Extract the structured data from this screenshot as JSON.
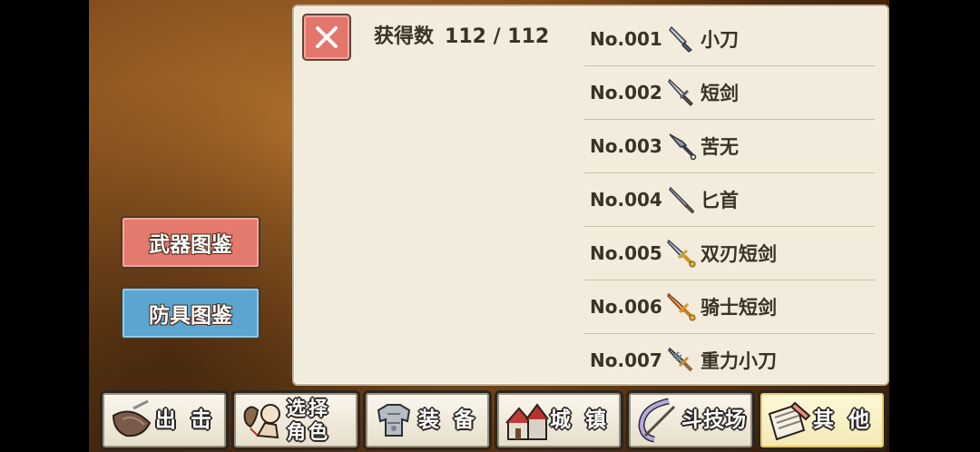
{
  "header": {
    "count_label": "获得数",
    "count_value": "112 / 112"
  },
  "close_icon": "close-x-icon",
  "weapons": [
    {
      "no": "No.001",
      "name": "小刀",
      "icon": "knife-icon"
    },
    {
      "no": "No.002",
      "name": "短剑",
      "icon": "short-sword-icon"
    },
    {
      "no": "No.003",
      "name": "苦无",
      "icon": "kunai-icon"
    },
    {
      "no": "No.004",
      "name": "匕首",
      "icon": "dagger-icon"
    },
    {
      "no": "No.005",
      "name": "双刃短剑",
      "icon": "twin-blade-icon"
    },
    {
      "no": "No.006",
      "name": "骑士短剑",
      "icon": "knight-sword-icon"
    },
    {
      "no": "No.007",
      "name": "重力小刀",
      "icon": "gravity-knife-icon"
    }
  ],
  "side_menu": {
    "weapons_label": "武器图鉴",
    "armor_label": "防具图鉴"
  },
  "bottom_nav": [
    {
      "line1": "出 击",
      "icon": "sortie-icon"
    },
    {
      "line1": "选择",
      "line2": "角色",
      "icon": "character-select-icon"
    },
    {
      "line1": "装 备",
      "icon": "equipment-icon"
    },
    {
      "line1": "城 镇",
      "icon": "town-icon"
    },
    {
      "line1": "斗技场",
      "icon": "arena-icon"
    },
    {
      "line1": "其 他",
      "icon": "other-icon"
    }
  ],
  "colors": {
    "panel_bg": "#f3ebdc",
    "weapons_button": "#e37a6d",
    "armor_button": "#5aa6d0",
    "close_button": "#e4756b"
  }
}
